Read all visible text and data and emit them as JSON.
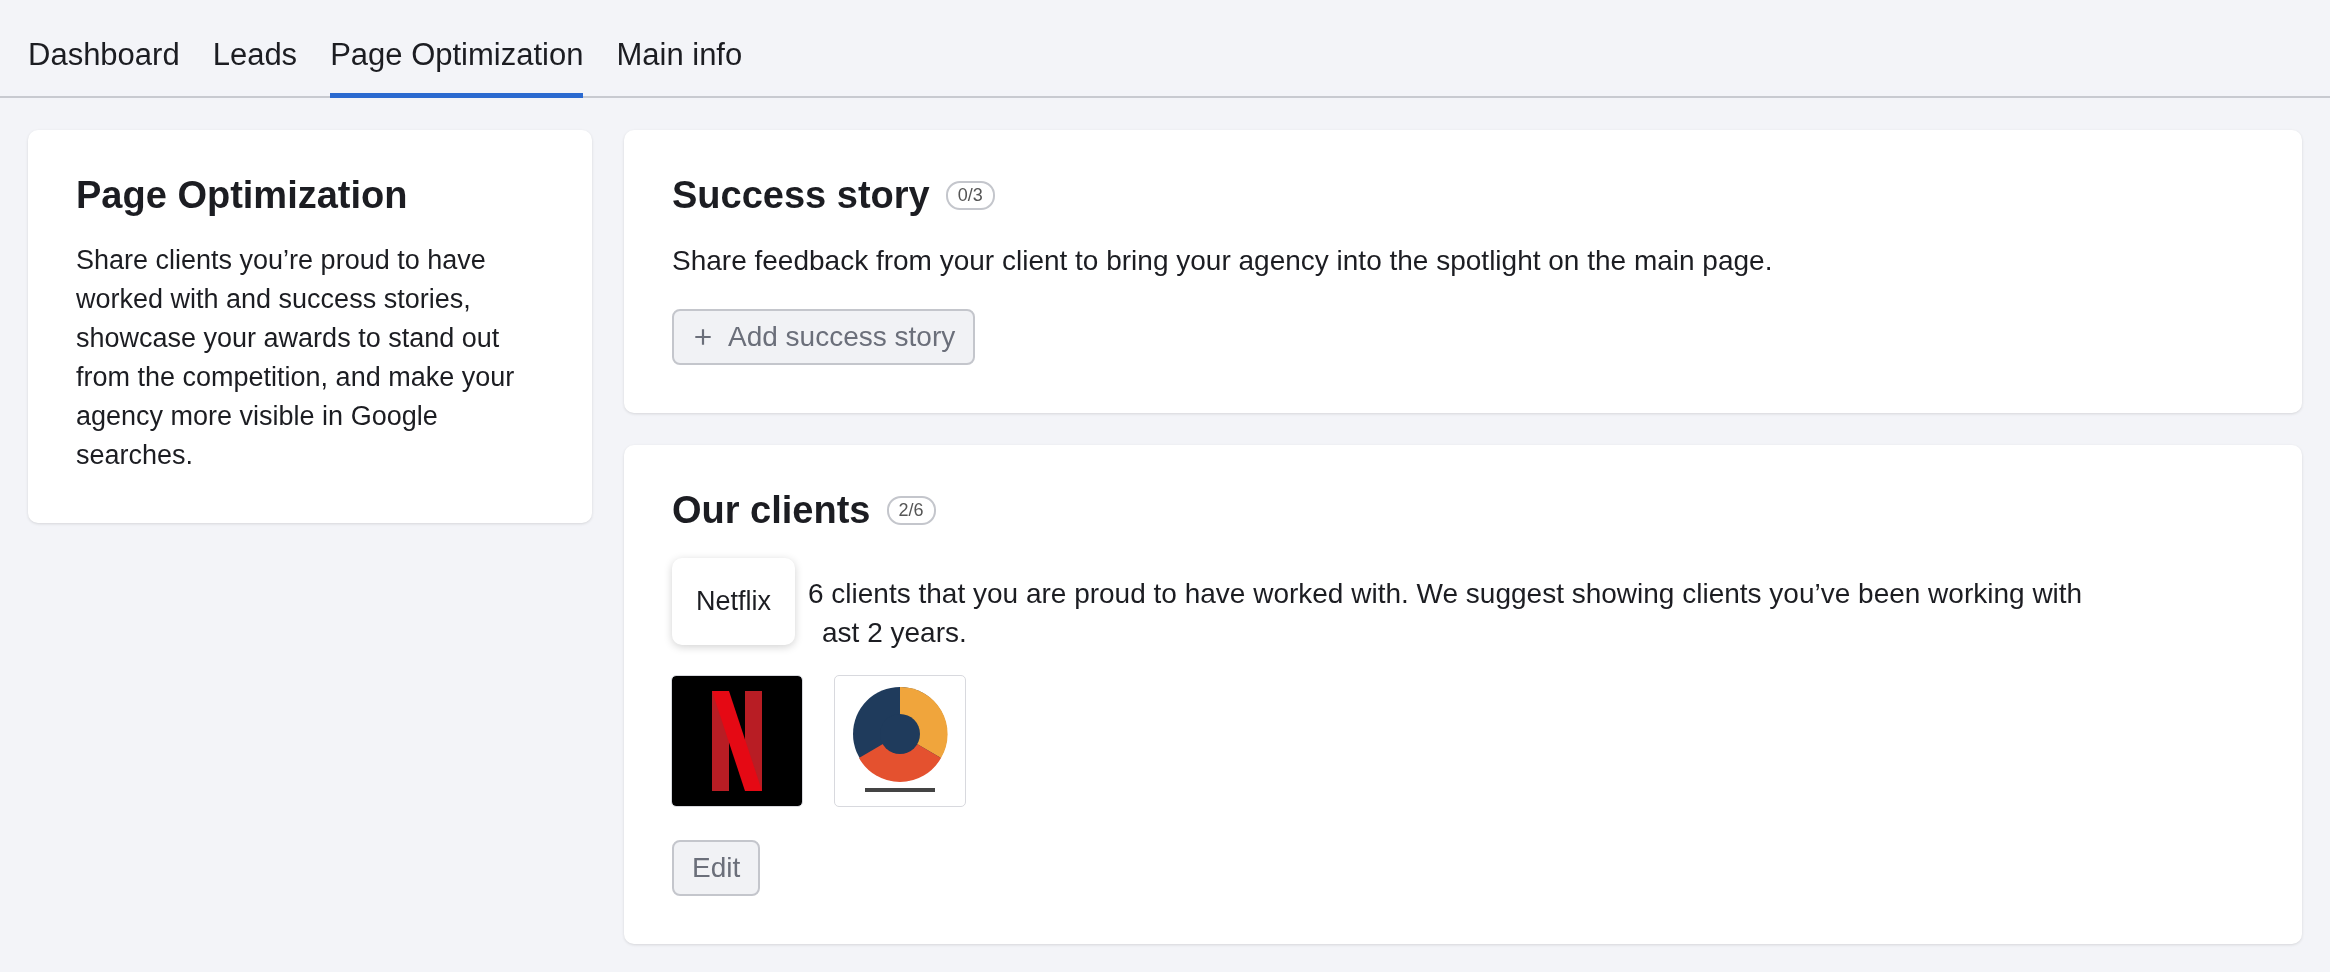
{
  "tabs": [
    {
      "label": "Dashboard",
      "selected": false
    },
    {
      "label": "Leads",
      "selected": false
    },
    {
      "label": "Page Optimization",
      "selected": true
    },
    {
      "label": "Main info",
      "selected": false
    }
  ],
  "intro": {
    "title": "Page Optimization",
    "text": "Share clients you’re proud to have worked with and success stories, showcase your awards to stand out from the competition, and make your agency more visible in Google searches."
  },
  "success_story": {
    "title": "Success story",
    "count": "0/3",
    "description": "Share feedback from your client to bring your agency into the spotlight on the main page.",
    "button": "Add success story"
  },
  "clients": {
    "title": "Our clients",
    "count": "2/6",
    "description_lines": [
      "6 clients that you are proud to have worked with. We suggest showing clients you’ve been working with",
      "ast 2 years."
    ],
    "tooltip": "Netflix",
    "button": "Edit"
  }
}
